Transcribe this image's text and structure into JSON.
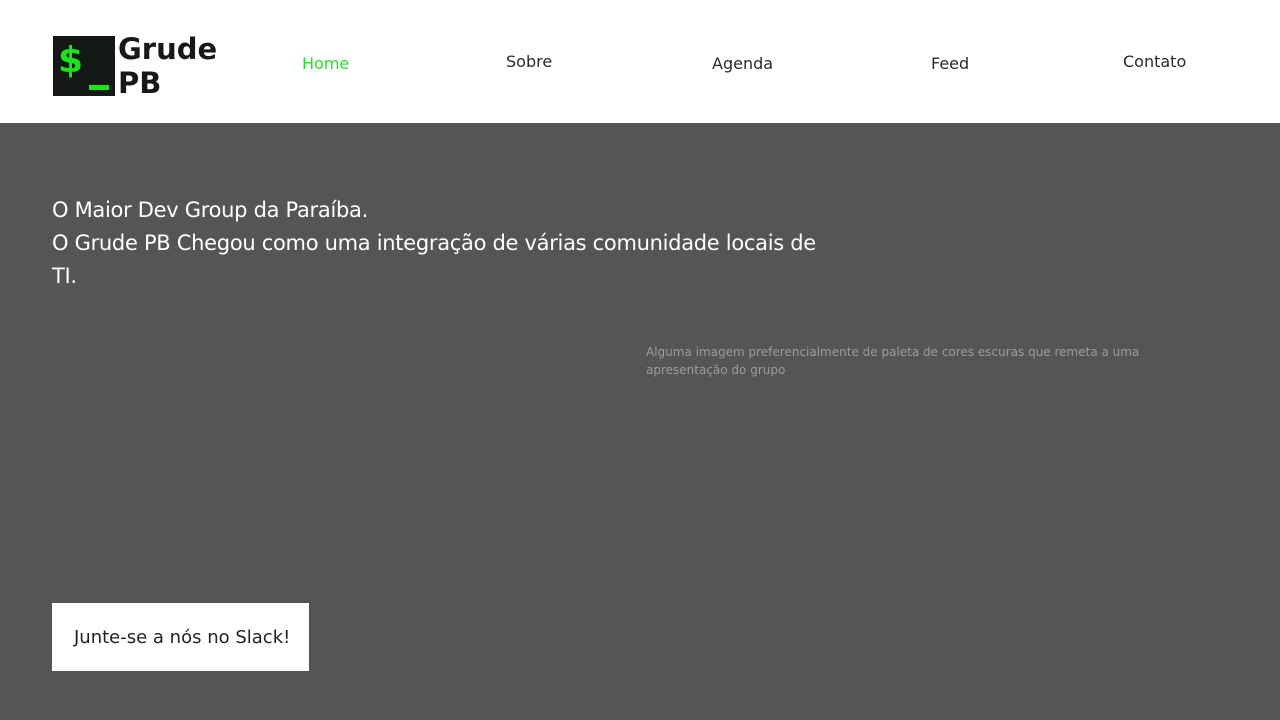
{
  "header": {
    "logo": {
      "symbol": "$_",
      "line1": "Grude",
      "line2": "PB"
    },
    "nav": [
      {
        "label": "Home",
        "active": true
      },
      {
        "label": "Sobre",
        "active": false
      },
      {
        "label": "Agenda",
        "active": false
      },
      {
        "label": "Feed",
        "active": false
      },
      {
        "label": "Contato",
        "active": false
      }
    ]
  },
  "hero": {
    "line1": "O Maior Dev Group da Paraíba.",
    "line2": "O Grude PB Chegou como uma integração de várias comunidade locais de TI.",
    "image_placeholder": "Alguma imagem preferencialmente de paleta de cores escuras que remeta a uma apresentação do grupo",
    "cta_label": "Junte-se a nós no Slack!"
  },
  "colors": {
    "accent": "#22e022",
    "background": "#555555",
    "header_bg": "#ffffff"
  }
}
